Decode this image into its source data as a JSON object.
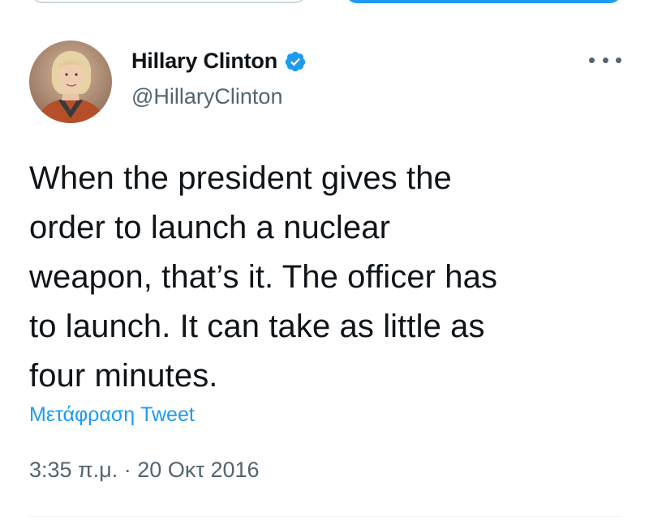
{
  "author": {
    "name": "Hillary Clinton",
    "handle": "@HillaryClinton",
    "verified": true,
    "verified_color": "#1d9bf0"
  },
  "tweet": {
    "lines": [
      "When the president gives the",
      "order to launch a nuclear",
      "weapon, that’s it. The officer has",
      "to launch. It can take as little as",
      "four minutes."
    ],
    "translate_label": "Μετάφραση Tweet",
    "time": "3:35 π.μ.",
    "separator": "·",
    "date": "20 Οκτ 2016"
  },
  "icons": {
    "verified": "verified-badge-icon",
    "more": "more-options-icon"
  },
  "colors": {
    "accent": "#1d9bf0",
    "text": "#0f1419",
    "secondary": "#536471"
  }
}
